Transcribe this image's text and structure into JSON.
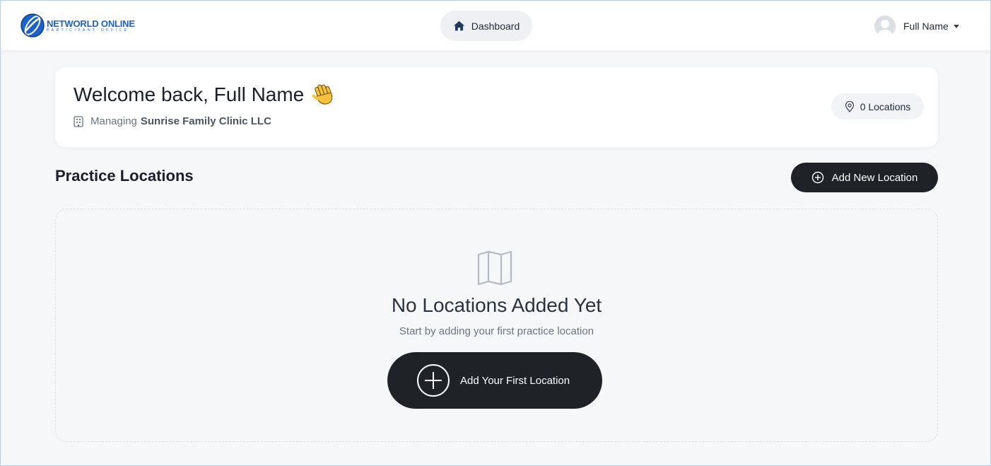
{
  "brand": {
    "title": "NETWORLD ONLINE",
    "subtitle": "PARTICIPANT OFFICE"
  },
  "nav": {
    "dashboard_label": "Dashboard"
  },
  "user": {
    "name": "Full Name"
  },
  "welcome": {
    "title": "Welcome back, Full Name",
    "managing_prefix": "Managing",
    "organization": "Sunrise Family Clinic LLC",
    "locations_badge": "0 Locations"
  },
  "section": {
    "title": "Practice Locations",
    "add_button_label": "Add New Location"
  },
  "empty_state": {
    "title": "No Locations Added Yet",
    "subtitle": "Start by adding your first practice location",
    "button_label": "Add Your First Location"
  },
  "colors": {
    "brand_blue": "#1d62c9",
    "button_dark": "#1f2328",
    "page_bg": "#f6f7f9"
  },
  "icons": {
    "nav": "home-icon",
    "managing": "building-icon",
    "badge": "map-pin-icon",
    "add": "plus-circle-icon",
    "empty": "map-icon",
    "greeting": "waving-hand-icon"
  }
}
